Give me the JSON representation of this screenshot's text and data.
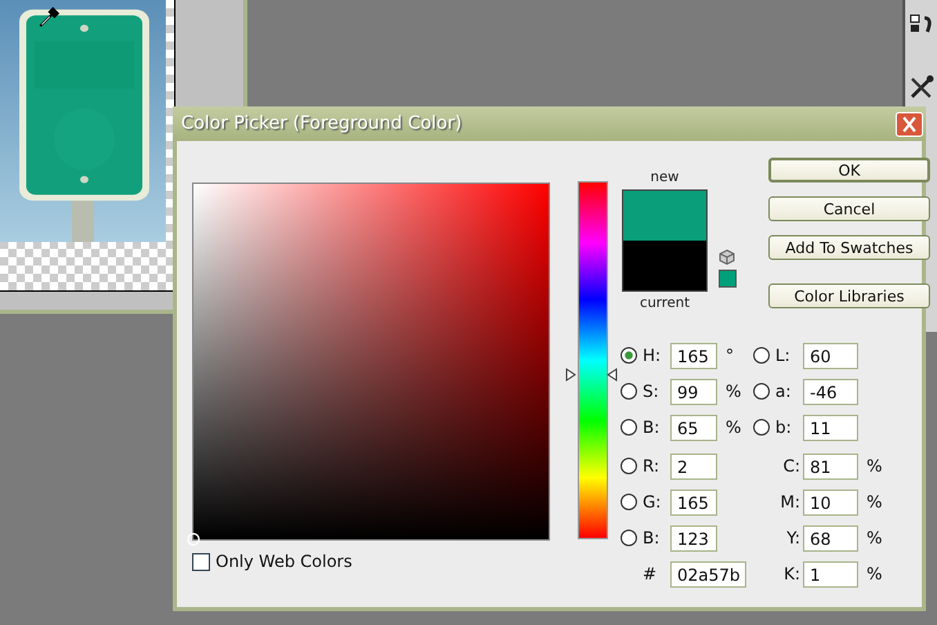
{
  "dialog": {
    "title": "Color Picker (Foreground Color)"
  },
  "hue_slider": {
    "level": 0.458
  },
  "swatches": [
    {
      "label": "new",
      "color": "#0a9e7a"
    },
    {
      "label": "current",
      "color": "#000000"
    }
  ],
  "web_color_swatch": {
    "color": "#00a07a"
  },
  "buttons": [
    {
      "label": "OK",
      "default": true
    },
    {
      "label": "Cancel",
      "default": false
    },
    {
      "label": "Add To Swatches",
      "default": false
    },
    {
      "label": "Color Libraries",
      "default": false
    }
  ],
  "values_left": [
    {
      "kind": "radio",
      "label": "H:",
      "value": "165",
      "unit": "°",
      "selected": true
    },
    {
      "kind": "radio",
      "label": "S:",
      "value": "99",
      "unit": "%",
      "selected": false
    },
    {
      "kind": "radio",
      "label": "B:",
      "value": "65",
      "unit": "%",
      "selected": false
    },
    {
      "kind": "radio",
      "label": "R:",
      "value": "2",
      "selected": false
    },
    {
      "kind": "radio",
      "label": "G:",
      "value": "165",
      "selected": false
    },
    {
      "kind": "radio",
      "label": "B:",
      "value": "123",
      "selected": false
    },
    {
      "kind": "plain",
      "label": "#",
      "value": "02a57b"
    }
  ],
  "values_right": [
    {
      "kind": "radio",
      "label": "L:",
      "value": "60",
      "selected": false
    },
    {
      "kind": "radio",
      "label": "a:",
      "value": "-46",
      "selected": false
    },
    {
      "kind": "radio",
      "label": "b:",
      "value": "11",
      "selected": false
    },
    {
      "kind": "plain",
      "label": "C:",
      "value": "81",
      "unit": "%"
    },
    {
      "kind": "plain",
      "label": "M:",
      "value": "10",
      "unit": "%"
    },
    {
      "kind": "plain",
      "label": "Y:",
      "value": "68",
      "unit": "%"
    },
    {
      "kind": "plain",
      "label": "K:",
      "value": "1",
      "unit": "%"
    }
  ],
  "only_web_colors": {
    "label": "Only Web Colors",
    "checked": false
  }
}
